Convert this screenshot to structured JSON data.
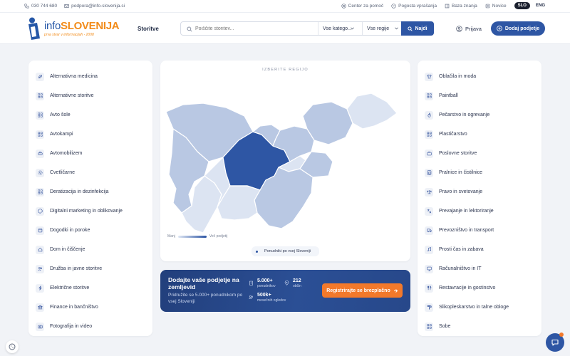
{
  "topbar": {
    "phone": "030 744 680",
    "email": "podpora@info-slovenija.si",
    "links": [
      "Center za pomoč",
      "Pogosta vprašanja",
      "Baza znanja",
      "Novice"
    ],
    "languages": [
      "SLO",
      "ENG"
    ],
    "active_language": "SLO"
  },
  "header": {
    "logo_main_1": "info",
    "logo_main_2": "SLOVENIJA",
    "logo_tagline": "prva stvar v informacijah - 2008",
    "nav_label": "Storitve",
    "search_placeholder": "Poiščite storitev...",
    "category_select": "Vse katego...",
    "region_select": "Vse regije",
    "find_button": "Najdi",
    "login_button": "Prijava",
    "add_company_button": "Dodaj podjetje"
  },
  "categories_left": [
    {
      "label": "Alternativna medicina",
      "icon": "leaf-icon"
    },
    {
      "label": "Alternativne storitve",
      "icon": "grid-icon"
    },
    {
      "label": "Avto šole",
      "icon": "grid-icon"
    },
    {
      "label": "Avtokampi",
      "icon": "grid-icon"
    },
    {
      "label": "Avtomobilizem",
      "icon": "car-icon"
    },
    {
      "label": "Cvetličarne",
      "icon": "flower-icon"
    },
    {
      "label": "Deratizacija in dezinfekcija",
      "icon": "grid-icon"
    },
    {
      "label": "Digitalni marketing in oblikovanje",
      "icon": "palette-icon"
    },
    {
      "label": "Dogodki in poroke",
      "icon": "calendar-icon"
    },
    {
      "label": "Dom in čiščenje",
      "icon": "home-icon"
    },
    {
      "label": "Družba in javne storitve",
      "icon": "people-icon"
    },
    {
      "label": "Električne storitve",
      "icon": "bolt-icon"
    },
    {
      "label": "Finance in bančništvo",
      "icon": "bank-icon"
    },
    {
      "label": "Fotografija in video",
      "icon": "camera-icon"
    }
  ],
  "categories_right": [
    {
      "label": "Oblačila in moda",
      "icon": "shirt-icon"
    },
    {
      "label": "Paintball",
      "icon": "grid-icon"
    },
    {
      "label": "Pečarstvo in ogrevanje",
      "icon": "flame-icon"
    },
    {
      "label": "Plastičarstvo",
      "icon": "grid-icon"
    },
    {
      "label": "Poslovne storitve",
      "icon": "briefcase-icon"
    },
    {
      "label": "Pralnice in čistilnice",
      "icon": "washer-icon"
    },
    {
      "label": "Pravo in svetovanje",
      "icon": "scale-icon"
    },
    {
      "label": "Prevajanje in lektoriranje",
      "icon": "translate-icon"
    },
    {
      "label": "Prevozništvo in transport",
      "icon": "truck-icon"
    },
    {
      "label": "Prosti čas in zabava",
      "icon": "music-icon"
    },
    {
      "label": "Računalništvo in IT",
      "icon": "monitor-icon"
    },
    {
      "label": "Restavracije in gostinstvo",
      "icon": "cutlery-icon"
    },
    {
      "label": "Slikopleskarstvo in talne obloge",
      "icon": "roller-icon"
    },
    {
      "label": "Sobe",
      "icon": "grid-icon"
    }
  ],
  "map": {
    "title": "IZBERITE REGIJO",
    "legend_min": "Manj",
    "legend_max": "Več podjetij",
    "note": "Ponudniki po vsej Sloveniji",
    "colors": {
      "light": "#dce4f2",
      "mid": "#b9c8e3",
      "dark": "#93a9d3",
      "active": "#2e56a4"
    }
  },
  "promo": {
    "title": "Dodajte vaše podjetje na zemljevid",
    "subtitle": "Pridružite se 5.000+ ponudnikom po vsej Sloveniji",
    "stats": [
      {
        "value": "5.000+",
        "label": "ponudnikov"
      },
      {
        "value": "212",
        "label": "občin"
      },
      {
        "value": "500k+",
        "label": "mesečnih ogledov"
      }
    ],
    "button": "Registrirajte se brezplačno"
  },
  "theme": {
    "primary": "#2e56a4",
    "accent": "#f2792b",
    "dark": "#1a1f2e"
  }
}
